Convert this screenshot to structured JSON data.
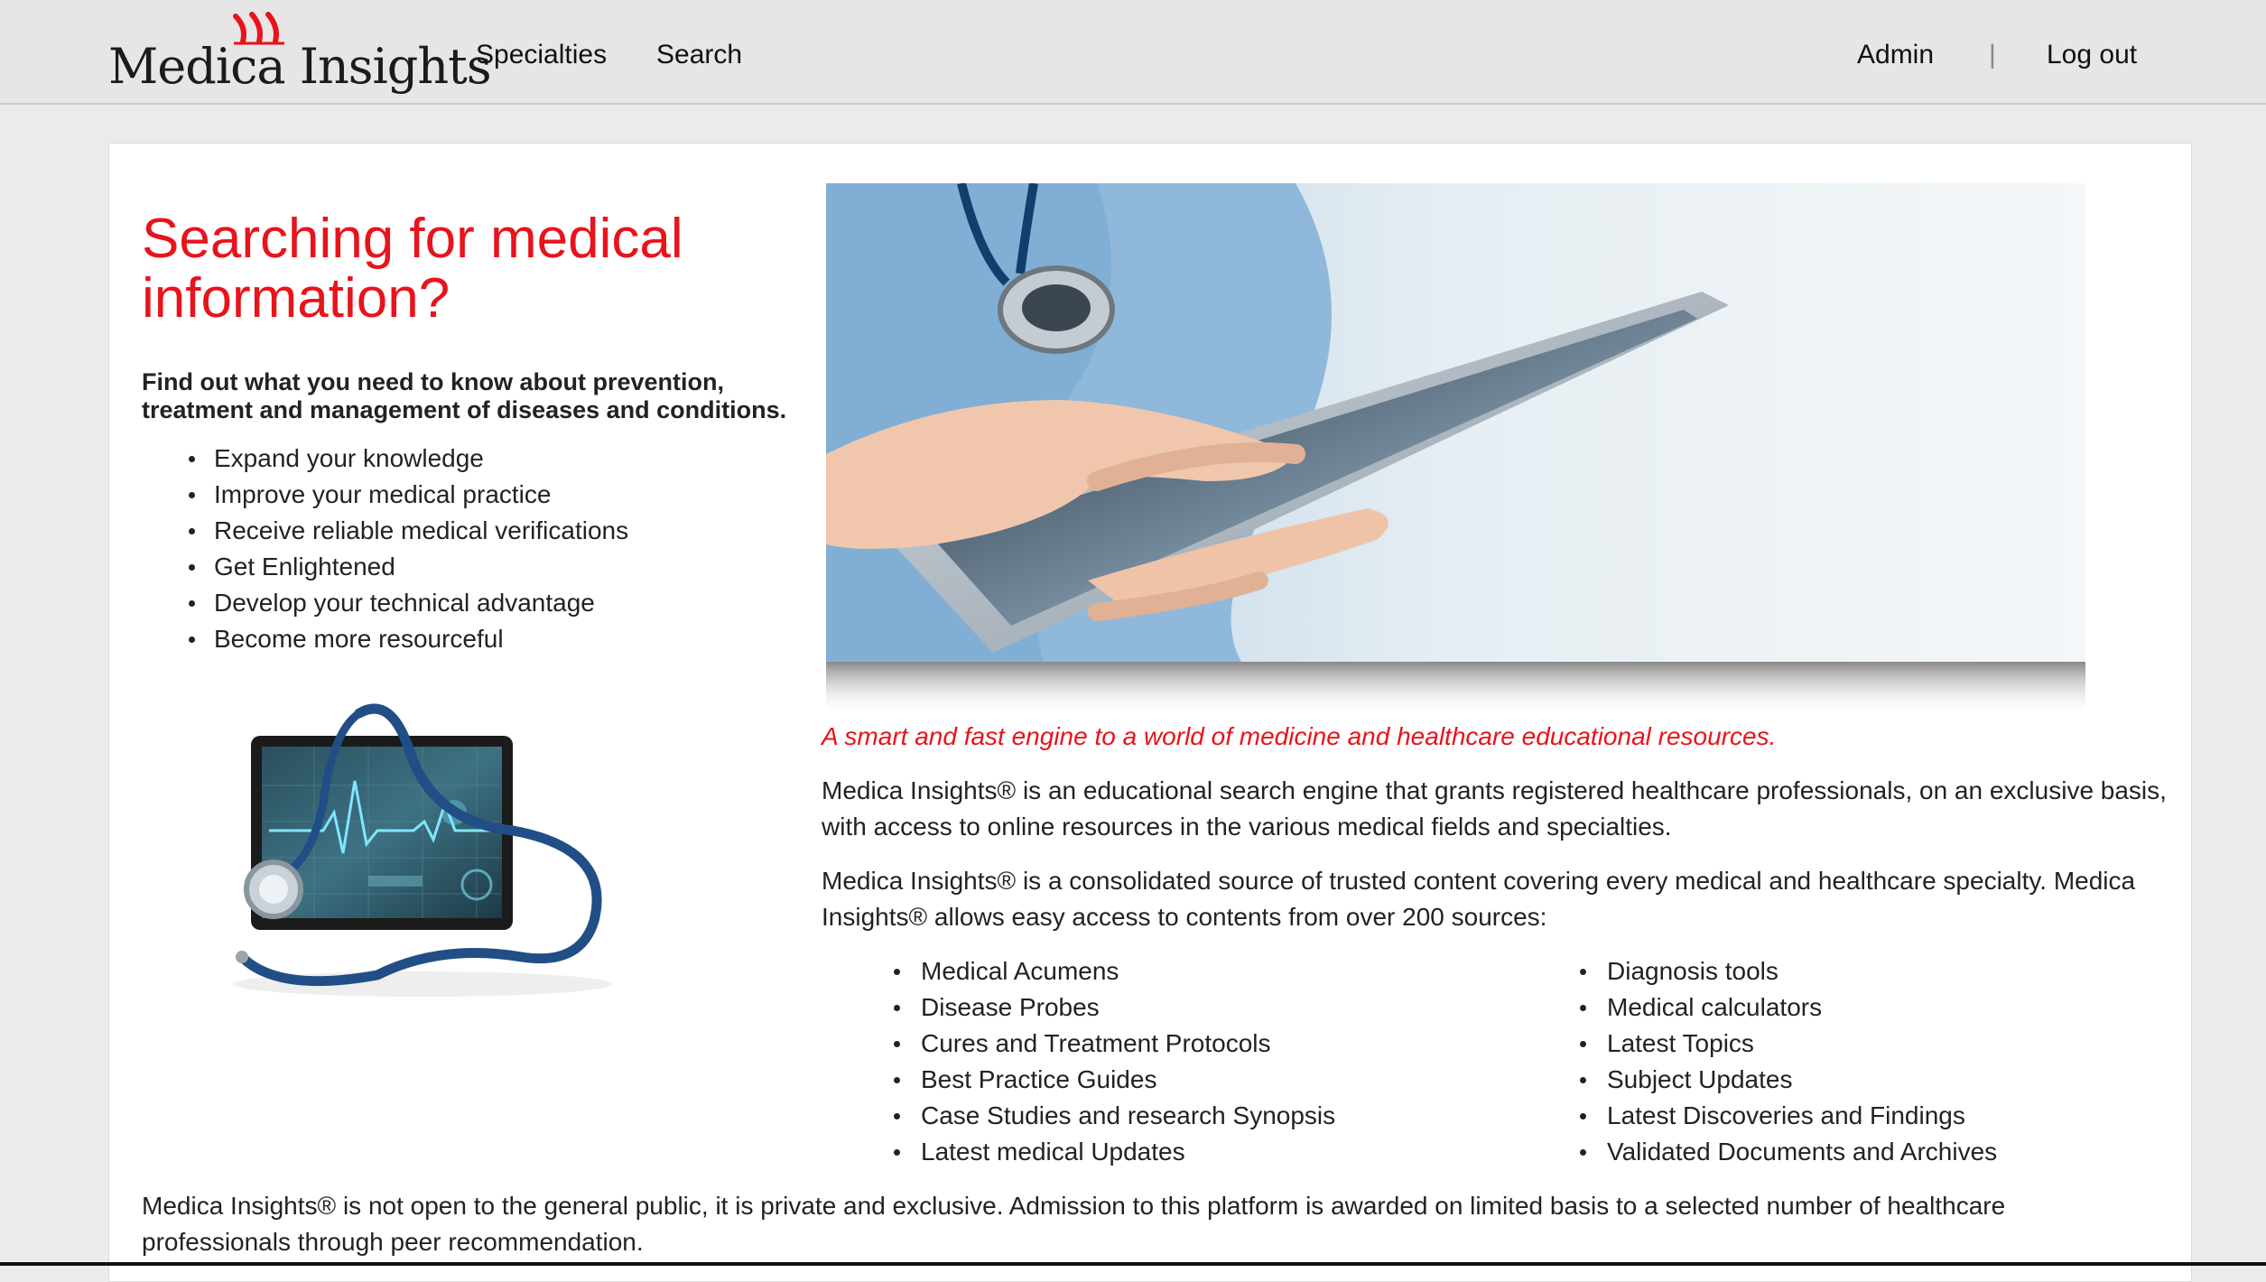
{
  "brand": {
    "name": "Medica Insights",
    "accent": "#e8131b"
  },
  "nav": {
    "specialties": "Specialties",
    "search": "Search",
    "admin": "Admin",
    "separator": "|",
    "logout": "Log out"
  },
  "hero": {
    "title": "Searching for medical information?",
    "lead": "Find out what you need to know about prevention, treatment and management of diseases and conditions.",
    "benefits": [
      "Expand your knowledge",
      "Improve your medical practice",
      "Receive reliable medical verifications",
      "Get Enlightened",
      "Develop your technical advantage",
      "Become more resourceful"
    ]
  },
  "images": {
    "hero": "nurse-holding-tablet-photo",
    "device": "tablet-with-stethoscope-illustration"
  },
  "content": {
    "tagline": "A smart and fast engine to a world of medicine and healthcare educational resources.",
    "para1": "Medica Insights® is an educational search engine that grants registered healthcare professionals, on an exclusive basis, with access to online resources in the various medical fields and specialties.",
    "para2": "Medica Insights® is a consolidated source of trusted content covering every medical and healthcare specialty. Medica Insights® allows easy access to contents from over 200 sources:",
    "sources_left": [
      "Medical Acumens",
      "Disease Probes",
      "Cures and Treatment Protocols",
      "Best Practice Guides",
      "Case Studies and research Synopsis",
      "Latest medical Updates"
    ],
    "sources_right": [
      "Diagnosis tools",
      "Medical calculators",
      "Latest Topics",
      "Subject Updates",
      "Latest Discoveries and Findings",
      "Validated Documents and Archives"
    ],
    "footer_note": "Medica Insights® is not open to the general public, it is private and exclusive. Admission to this platform is awarded on limited basis to a selected number of healthcare professionals through peer recommendation."
  }
}
